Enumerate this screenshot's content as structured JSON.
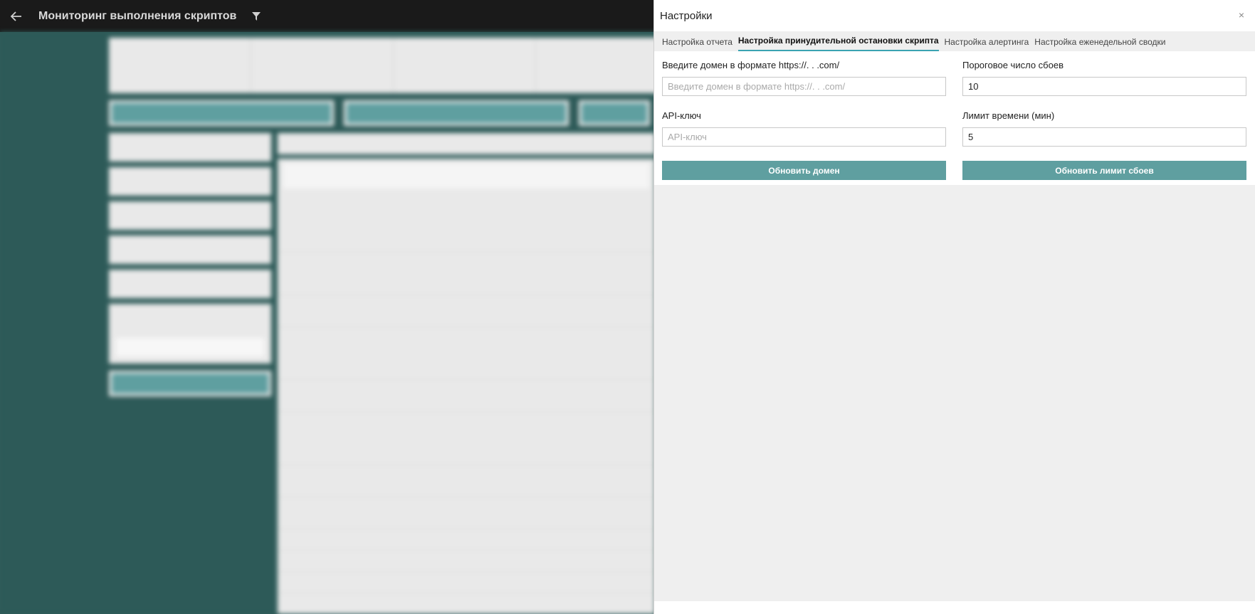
{
  "header": {
    "title": "Мониторинг выполнения скриптов",
    "back_icon": "arrow-left-icon",
    "filter_icon": "funnel-icon"
  },
  "settings": {
    "title": "Настройки",
    "close_label": "×",
    "tabs": [
      {
        "label": "Настройка отчета",
        "active": false
      },
      {
        "label": "Настройка принудительной остановки скрипта",
        "active": true
      },
      {
        "label": "Настройка алертинга",
        "active": false
      },
      {
        "label": "Настройка еженедельной сводки",
        "active": false
      }
    ],
    "domain": {
      "label": "Введите домен в формате https://. . .com/",
      "placeholder": "Введите домен в формате https://. . .com/",
      "value": ""
    },
    "failure_threshold": {
      "label": "Пороговое число сбоев",
      "value": "10"
    },
    "api_key": {
      "label": "API-ключ",
      "placeholder": "API-ключ",
      "value": ""
    },
    "time_limit": {
      "label": "Лимит времени (мин)",
      "value": "5"
    },
    "update_domain_label": "Обновить домен",
    "update_limit_label": "Обновить лимит сбоев"
  },
  "colors": {
    "accent": "#5f9fa0",
    "tab_underline": "#3aa3b2",
    "background": "#2d5a58",
    "topbar": "#1a1a1a"
  }
}
